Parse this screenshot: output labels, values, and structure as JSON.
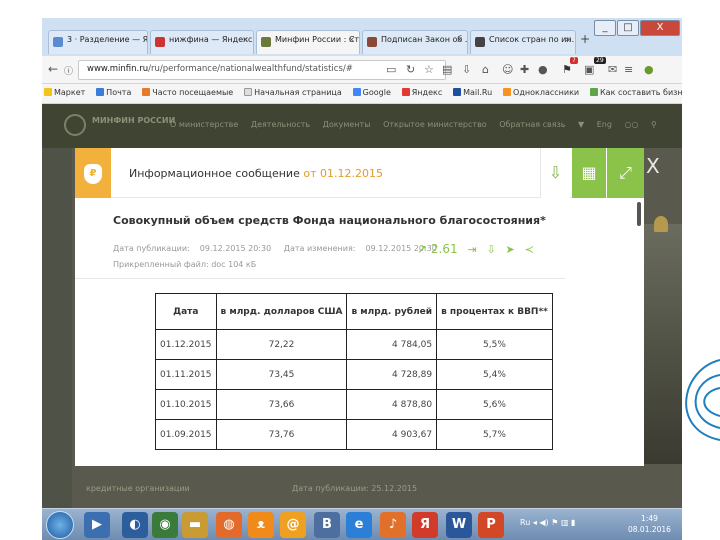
{
  "browser": {
    "tabs": [
      {
        "label": "3 · Разделение — Яну...",
        "active": false
      },
      {
        "label": "нижфина — Яндекс ...",
        "active": false
      },
      {
        "label": "Минфин России : Стати...",
        "active": true
      },
      {
        "label": "Подписан Закон об ...",
        "active": false
      },
      {
        "label": "Список стран по ин...",
        "active": false
      }
    ],
    "new_tab": "+",
    "window_controls": {
      "minimize": "_",
      "maximize": "□",
      "close": "X"
    },
    "url_host": "www.minfin.ru",
    "url_path": "/ru/performance/nationalwealthfund/statistics/#",
    "badges": {
      "mail": "7",
      "notif": "29"
    },
    "bookmarks": [
      "Маркет",
      "Почта",
      "Часто посещаемые",
      "Начальная страница",
      "Google",
      "Яндекс",
      "Mail.Ru",
      "Одноклассники",
      "Как составить бизне..."
    ]
  },
  "site": {
    "name": "МИНФИН РОССИИ",
    "nav": [
      "О министерстве",
      "Деятельность",
      "Документы",
      "Открытое министерство",
      "Обратная связь",
      "▼",
      "Eng"
    ],
    "bg_left_text": "кредитные организации",
    "bg_right_text": "Дата публикации: 25.12.2015"
  },
  "modal": {
    "coin_symbol": "₽",
    "title": "Информационное сообщение",
    "title_date": "от 01.12.2015",
    "doc_title": "Совокупный объем средств Фонда национального благосостояния*",
    "meta_published_label": "Дата публикации:",
    "meta_published": "09.12.2015 20:30",
    "meta_changed_label": "Дата изменения:",
    "meta_changed": "09.12.2015 20:30",
    "meta_file": "Прикрепленный файл: doc 104 кБ",
    "rating": "2.61",
    "close": "X",
    "table": {
      "headers": [
        "Дата",
        "в млрд. долларов США",
        "в млрд. рублей",
        "в процентах к ВВП**"
      ],
      "rows": [
        [
          "01.12.2015",
          "72,22",
          "4 784,05",
          "5,5%"
        ],
        [
          "01.11.2015",
          "73,45",
          "4 728,89",
          "5,4%"
        ],
        [
          "01.10.2015",
          "73,66",
          "4 878,80",
          "5,6%"
        ],
        [
          "01.09.2015",
          "73,76",
          "4 903,67",
          "5,7%"
        ]
      ]
    }
  },
  "taskbar": {
    "lang": "Ru",
    "time": "1:49",
    "date": "08.01.2016"
  }
}
